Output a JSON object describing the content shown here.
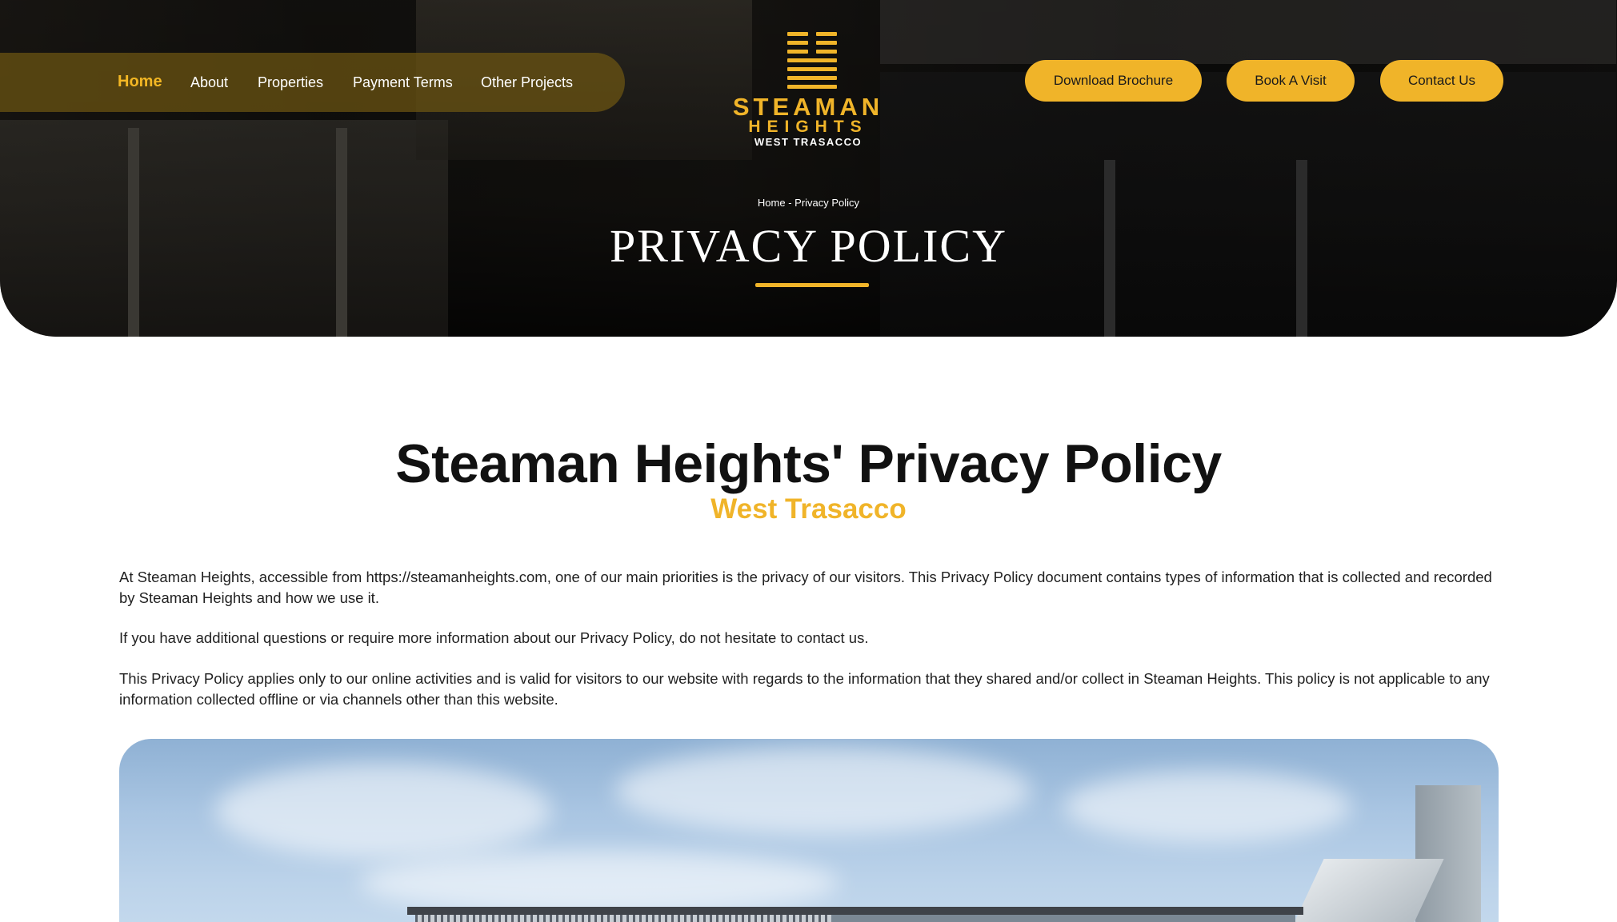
{
  "nav": {
    "items": [
      {
        "label": "Home",
        "active": true
      },
      {
        "label": "About"
      },
      {
        "label": "Properties"
      },
      {
        "label": "Payment Terms"
      },
      {
        "label": "Other Projects"
      }
    ]
  },
  "logo": {
    "name": "STEAMAN",
    "sub": "HEIGHTS",
    "location": "WEST TRASACCO"
  },
  "actions": {
    "download_brochure": "Download Brochure",
    "book_visit": "Book A Visit",
    "contact_us": "Contact Us"
  },
  "hero": {
    "breadcrumb": "Home - Privacy Policy",
    "title": "PRIVACY POLICY"
  },
  "content": {
    "heading": "Steaman Heights' Privacy Policy",
    "subheading": "West Trasacco",
    "paragraphs": [
      "At Steaman Heights, accessible from https://steamanheights.com, one of our main priorities is the privacy of our visitors. This Privacy Policy document contains types of information that is collected and recorded by Steaman Heights and how we use it.",
      "If you have additional questions or require more information about our Privacy Policy, do not hesitate to contact us.",
      "This Privacy Policy applies only to our online activities and is valid for visitors to our website with regards to the information that they shared and/or collect in Steaman Heights. This policy is not applicable to any information collected offline or via channels other than this website."
    ]
  },
  "colors": {
    "accent": "#f0b429",
    "text": "#222222",
    "heading": "#111111"
  },
  "icons": [
    "steaman-heights-logo-icon"
  ]
}
